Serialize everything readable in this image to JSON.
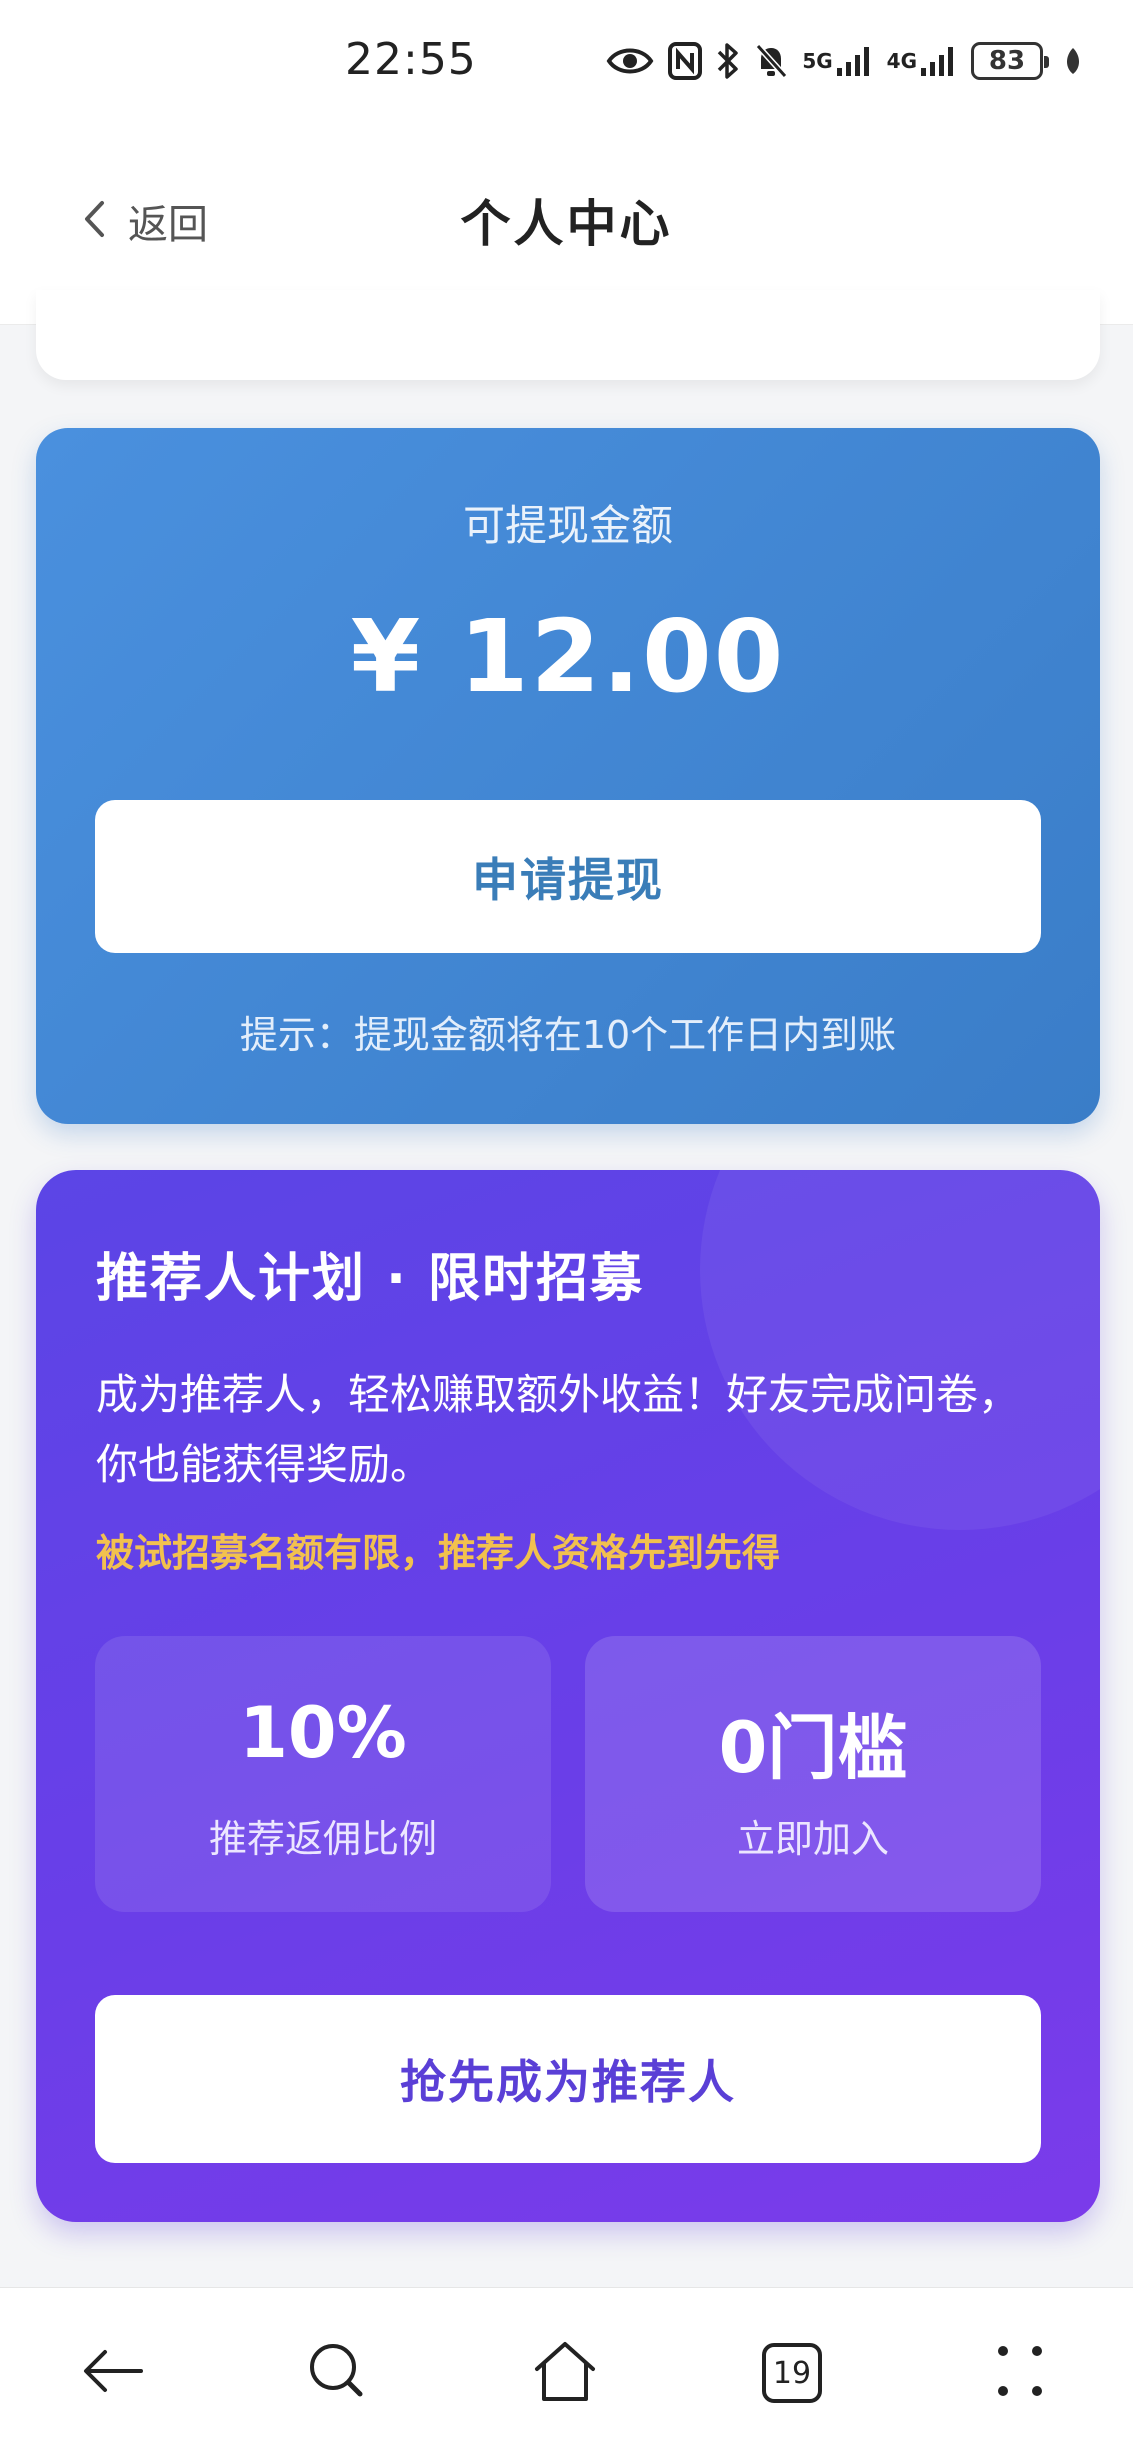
{
  "status_bar": {
    "time": "22:55",
    "network_5g": "5G",
    "network_4g": "4G",
    "battery": "83"
  },
  "header": {
    "back_label": "返回",
    "title": "个人中心"
  },
  "withdraw": {
    "label": "可提现金额",
    "amount": "¥ 12.00",
    "button_label": "申请提现",
    "tip": "提示：提现金额将在10个工作日内到账"
  },
  "referral": {
    "title": "推荐人计划 · 限时招募",
    "description": "成为推荐人，轻松赚取额外收益！好友完成问卷，你也能获得奖励。",
    "highlight": "被试招募名额有限，推荐人资格先到先得",
    "stats": [
      {
        "value": "10%",
        "label": "推荐返佣比例"
      },
      {
        "value": "0门槛",
        "label": "立即加入"
      }
    ],
    "button_label": "抢先成为推荐人"
  },
  "bottom_nav": {
    "tab_count": "19"
  },
  "colors": {
    "withdraw_gradient_start": "#4a90de",
    "withdraw_gradient_end": "#3a7dc8",
    "referral_gradient_start": "#5b45e6",
    "referral_gradient_end": "#7b3bea",
    "highlight": "#f2c14e",
    "referral_button_text": "#5a3fd6",
    "withdraw_button_text": "#3a7db8"
  }
}
